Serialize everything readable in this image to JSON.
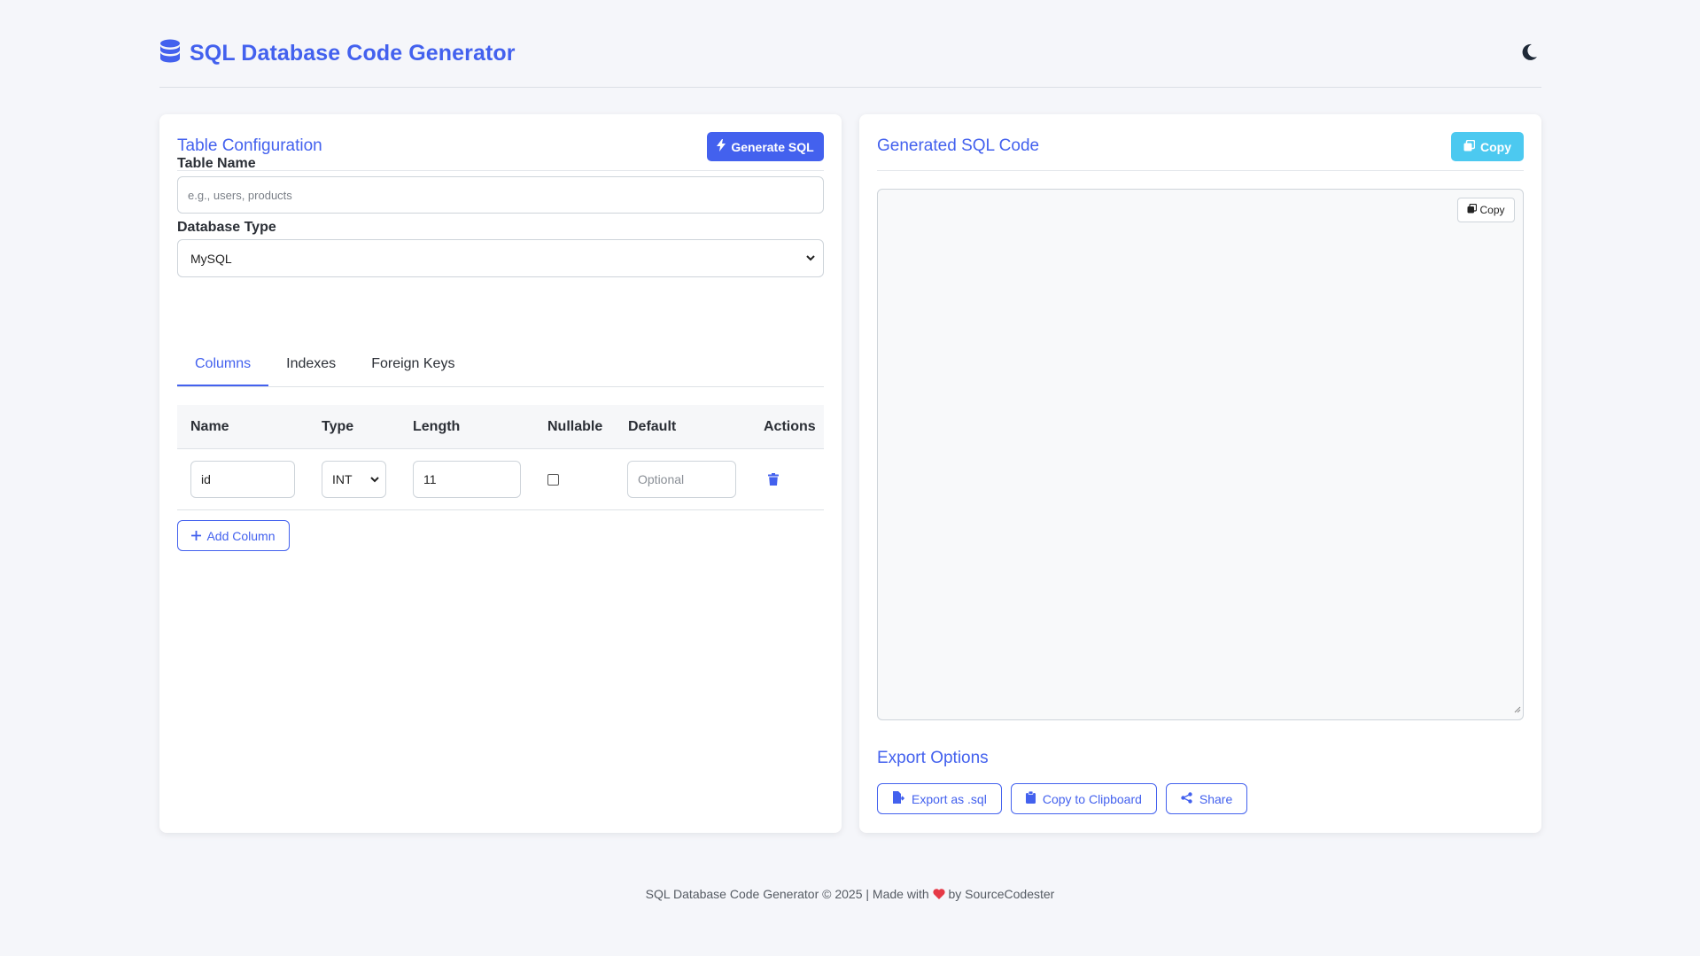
{
  "app": {
    "title": "SQL Database Code Generator"
  },
  "left_card": {
    "title": "Table Configuration",
    "generate_label": "Generate SQL",
    "table_name_label": "Table Name",
    "table_name_placeholder": "e.g., users, products",
    "table_name_value": "",
    "db_type_label": "Database Type",
    "db_type_value": "MySQL",
    "tabs": [
      {
        "label": "Columns",
        "active": true
      },
      {
        "label": "Indexes",
        "active": false
      },
      {
        "label": "Foreign Keys",
        "active": false
      }
    ],
    "columns_headers": [
      "Name",
      "Type",
      "Length",
      "Nullable",
      "Default",
      "Actions"
    ],
    "columns_rows": [
      {
        "name": "id",
        "type": "INT",
        "length": "11",
        "nullable": false,
        "default_placeholder": "Optional"
      }
    ],
    "add_column_label": "Add Column"
  },
  "right_card": {
    "title": "Generated SQL Code",
    "copy_label": "Copy",
    "inner_copy_label": "Copy",
    "code": "",
    "export_title": "Export Options",
    "export_buttons": [
      {
        "label": "Export as .sql",
        "icon": "file-export-icon"
      },
      {
        "label": "Copy to Clipboard",
        "icon": "clipboard-icon"
      },
      {
        "label": "Share",
        "icon": "share-icon"
      }
    ]
  },
  "footer": {
    "before": "SQL Database Code Generator © 2025 | Made with",
    "after": "by SourceCodester"
  },
  "colors": {
    "primary": "#4361ee",
    "accent": "#4cc9f0",
    "background": "#f5f6fa",
    "heart": "#e63946"
  }
}
